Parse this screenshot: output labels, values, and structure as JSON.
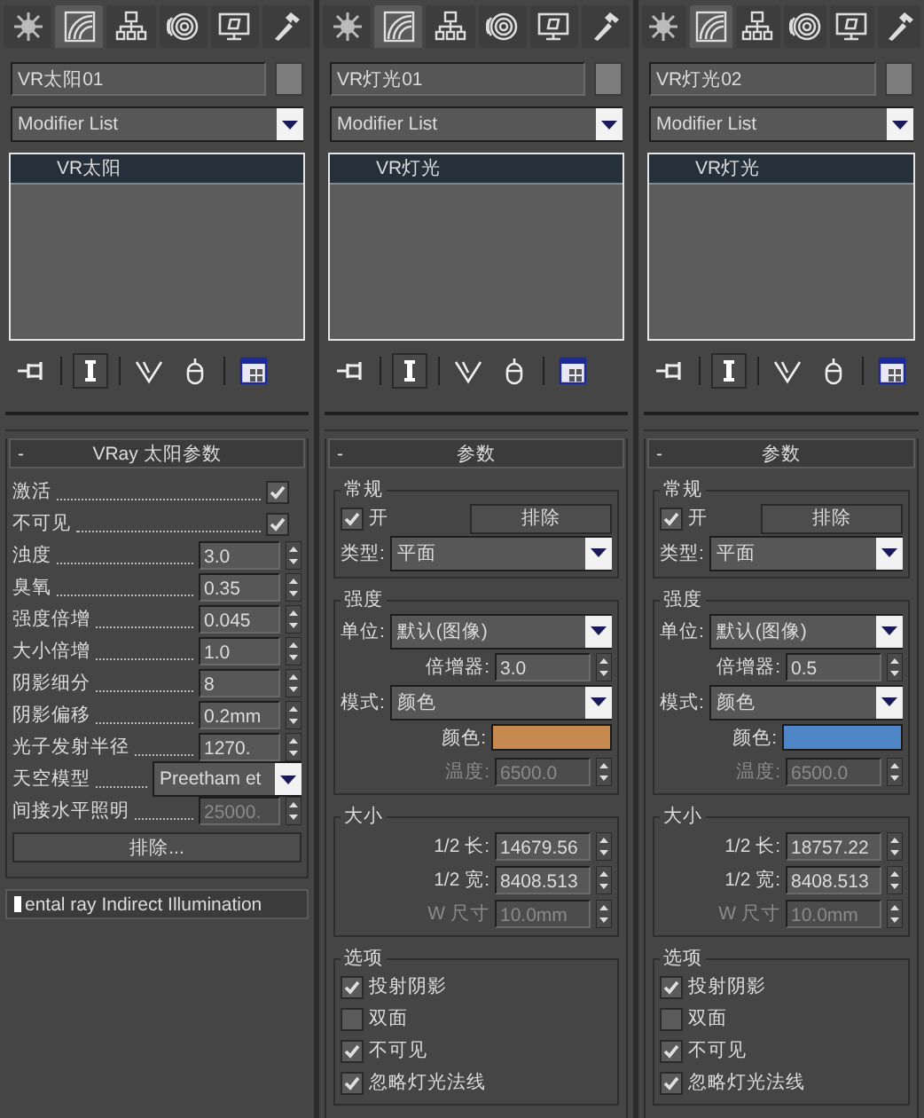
{
  "panels": [
    {
      "tabs": [
        {
          "kind": "create",
          "selected": false
        },
        {
          "kind": "modify",
          "selected": true
        },
        {
          "kind": "hierarchy",
          "selected": false
        },
        {
          "kind": "motion",
          "selected": false
        },
        {
          "kind": "display",
          "selected": false
        },
        {
          "kind": "utilities",
          "selected": false
        }
      ],
      "object_name": "VR太阳01",
      "modifier_list": "Modifier List",
      "stack": [
        {
          "label": "VR太阳",
          "selected": true
        }
      ],
      "toolbar": [
        {
          "kind": "pin",
          "selected": false
        },
        {
          "kind": "result",
          "selected": true
        },
        {
          "kind": "unique",
          "selected": false
        },
        {
          "kind": "remove",
          "selected": false
        },
        {
          "kind": "configure",
          "selected": false
        }
      ],
      "rollout": {
        "collapse": "-",
        "title": "VRay 太阳参数",
        "groups": [
          {
            "leaders": true,
            "rows": [
              {
                "kind": "check",
                "label": "激活",
                "checked": true
              },
              {
                "kind": "check",
                "label": "不可见",
                "checked": true
              },
              {
                "kind": "spinner",
                "label": "浊度",
                "value": "3.0",
                "disabled": false
              },
              {
                "kind": "spinner",
                "label": "臭氧",
                "value": "0.35",
                "disabled": false
              },
              {
                "kind": "spinner",
                "label": "强度倍增",
                "value": "0.045",
                "disabled": false
              },
              {
                "kind": "spinner",
                "label": "大小倍增",
                "value": "1.0",
                "disabled": false
              },
              {
                "kind": "spinner",
                "label": "阴影细分",
                "value": "8",
                "disabled": false
              },
              {
                "kind": "spinner",
                "label": "阴影偏移",
                "value": "0.2mm",
                "disabled": false
              },
              {
                "kind": "spinner",
                "label": "光子发射半径",
                "value": "1270.",
                "disabled": false
              },
              {
                "kind": "dropdown",
                "label": "天空模型",
                "value": "Preetham et"
              },
              {
                "kind": "spinner",
                "label": "间接水平照明",
                "value": "25000.",
                "disabled": true
              },
              {
                "kind": "button",
                "label": "排除..."
              }
            ]
          }
        ]
      },
      "next_rollout": "ental ray Indirect Illumination"
    },
    {
      "tabs": [
        {
          "kind": "create",
          "selected": false
        },
        {
          "kind": "modify",
          "selected": true
        },
        {
          "kind": "hierarchy",
          "selected": false
        },
        {
          "kind": "motion",
          "selected": false
        },
        {
          "kind": "display",
          "selected": false
        },
        {
          "kind": "utilities",
          "selected": false
        }
      ],
      "object_name": "VR灯光01",
      "modifier_list": "Modifier List",
      "stack": [
        {
          "label": "VR灯光",
          "selected": true
        }
      ],
      "toolbar": [
        {
          "kind": "pin",
          "selected": false
        },
        {
          "kind": "result",
          "selected": true
        },
        {
          "kind": "unique",
          "selected": false
        },
        {
          "kind": "remove",
          "selected": false
        },
        {
          "kind": "configure",
          "selected": false
        }
      ],
      "rollout": {
        "collapse": "-",
        "title": "参数",
        "groups": [
          {
            "leaders": false,
            "title": "常规",
            "rows": [
              {
                "kind": "checkbutton",
                "label": "开",
                "checked": true,
                "button": "排除"
              },
              {
                "kind": "dropdown",
                "label": "类型:",
                "value": "平面"
              }
            ]
          },
          {
            "leaders": false,
            "title": "强度",
            "rows": [
              {
                "kind": "dropdown",
                "label": "单位:",
                "value": "默认(图像)"
              },
              {
                "kind": "spinner",
                "label": "倍增器:",
                "value": "3.0",
                "disabled": false
              },
              {
                "kind": "dropdown",
                "label": "模式:",
                "value": "颜色"
              },
              {
                "kind": "color",
                "label": "颜色:",
                "color": "#c68a4e"
              },
              {
                "kind": "spinner",
                "label": "温度:",
                "value": "6500.0",
                "disabled": true
              }
            ]
          },
          {
            "leaders": false,
            "title": "大小",
            "rows": [
              {
                "kind": "spinner",
                "label": "1/2 长:",
                "value": "14679.56",
                "disabled": false
              },
              {
                "kind": "spinner",
                "label": "1/2 宽:",
                "value": "8408.513",
                "disabled": false
              },
              {
                "kind": "spinner",
                "label": "W 尺寸",
                "value": "10.0mm",
                "disabled": true
              }
            ]
          },
          {
            "leaders": false,
            "title": "选项",
            "rows": [
              {
                "kind": "check",
                "label": "投射阴影",
                "checked": true
              },
              {
                "kind": "check",
                "label": "双面",
                "checked": false
              },
              {
                "kind": "check",
                "label": "不可见",
                "checked": true
              },
              {
                "kind": "check",
                "label": "忽略灯光法线",
                "checked": true
              }
            ]
          }
        ]
      }
    },
    {
      "tabs": [
        {
          "kind": "create",
          "selected": false
        },
        {
          "kind": "modify",
          "selected": true
        },
        {
          "kind": "hierarchy",
          "selected": false
        },
        {
          "kind": "motion",
          "selected": false
        },
        {
          "kind": "display",
          "selected": false
        },
        {
          "kind": "utilities",
          "selected": false
        }
      ],
      "object_name": "VR灯光02",
      "modifier_list": "Modifier List",
      "stack": [
        {
          "label": "VR灯光",
          "selected": true
        }
      ],
      "toolbar": [
        {
          "kind": "pin",
          "selected": false
        },
        {
          "kind": "result",
          "selected": true
        },
        {
          "kind": "unique",
          "selected": false
        },
        {
          "kind": "remove",
          "selected": false
        },
        {
          "kind": "configure",
          "selected": false
        }
      ],
      "rollout": {
        "collapse": "-",
        "title": "参数",
        "groups": [
          {
            "leaders": false,
            "title": "常规",
            "rows": [
              {
                "kind": "checkbutton",
                "label": "开",
                "checked": true,
                "button": "排除"
              },
              {
                "kind": "dropdown",
                "label": "类型:",
                "value": "平面"
              }
            ]
          },
          {
            "leaders": false,
            "title": "强度",
            "rows": [
              {
                "kind": "dropdown",
                "label": "单位:",
                "value": "默认(图像)"
              },
              {
                "kind": "spinner",
                "label": "倍增器:",
                "value": "0.5",
                "disabled": false
              },
              {
                "kind": "dropdown",
                "label": "模式:",
                "value": "颜色"
              },
              {
                "kind": "color",
                "label": "颜色:",
                "color": "#4f86c8"
              },
              {
                "kind": "spinner",
                "label": "温度:",
                "value": "6500.0",
                "disabled": true
              }
            ]
          },
          {
            "leaders": false,
            "title": "大小",
            "rows": [
              {
                "kind": "spinner",
                "label": "1/2 长:",
                "value": "18757.22",
                "disabled": false
              },
              {
                "kind": "spinner",
                "label": "1/2 宽:",
                "value": "8408.513",
                "disabled": false
              },
              {
                "kind": "spinner",
                "label": "W 尺寸",
                "value": "10.0mm",
                "disabled": true
              }
            ]
          },
          {
            "leaders": false,
            "title": "选项",
            "rows": [
              {
                "kind": "check",
                "label": "投射阴影",
                "checked": true
              },
              {
                "kind": "check",
                "label": "双面",
                "checked": false
              },
              {
                "kind": "check",
                "label": "不可见",
                "checked": true
              },
              {
                "kind": "check",
                "label": "忽略灯光法线",
                "checked": true
              }
            ]
          }
        ]
      }
    }
  ]
}
